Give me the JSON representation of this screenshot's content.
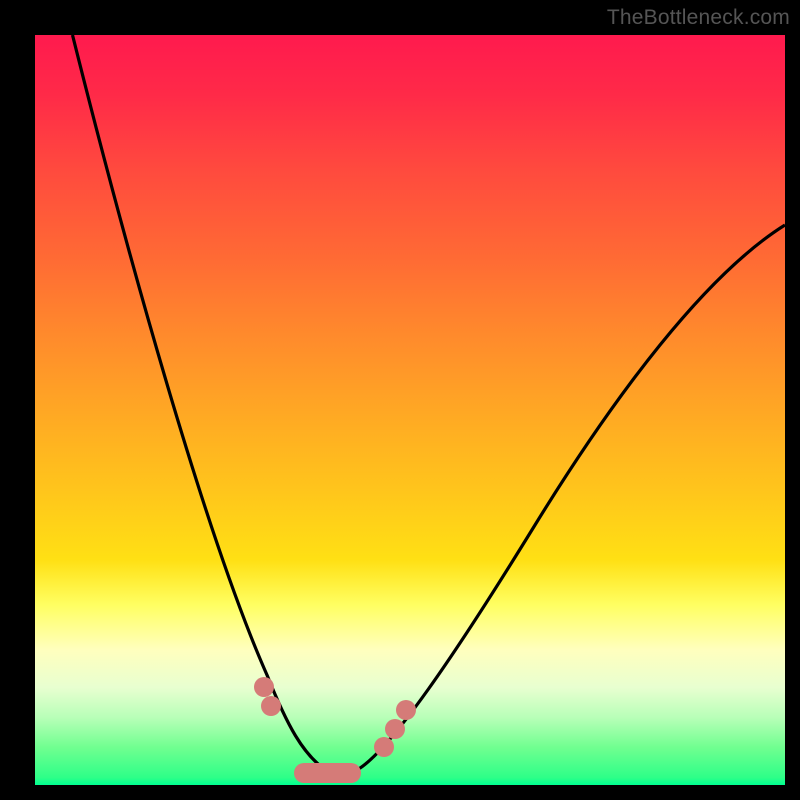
{
  "watermark_text": "TheBottleneck.com",
  "chart_data": {
    "type": "line",
    "title": "",
    "xlabel": "",
    "ylabel": "",
    "xlim": [
      0,
      100
    ],
    "ylim": [
      0,
      100
    ],
    "series": [
      {
        "name": "bottleneck-curve",
        "x": [
          5,
          10,
          15,
          20,
          25,
          28,
          31,
          33,
          35,
          37,
          39,
          41,
          43,
          46,
          50,
          55,
          60,
          65,
          70,
          75,
          80,
          85,
          90,
          95,
          100
        ],
        "y": [
          100,
          80,
          60,
          42,
          26,
          18,
          11,
          7,
          4,
          2,
          1,
          1,
          2,
          4,
          8,
          14,
          21,
          28,
          35,
          42,
          49,
          55,
          61,
          67,
          72
        ]
      }
    ],
    "left_markers": {
      "name": "left-side-markers",
      "points": [
        {
          "x": 30.5,
          "y": 13.0
        },
        {
          "x": 31.5,
          "y": 10.5
        }
      ]
    },
    "right_markers": {
      "name": "right-side-markers",
      "points": [
        {
          "x": 46.5,
          "y": 5.0
        },
        {
          "x": 48.0,
          "y": 7.5
        },
        {
          "x": 49.5,
          "y": 10.0
        }
      ]
    },
    "bottom_bar": {
      "name": "bottom-pill",
      "x_start": 34.5,
      "x_end": 43.5,
      "y": 1.5
    },
    "grid": false,
    "legend": false
  }
}
